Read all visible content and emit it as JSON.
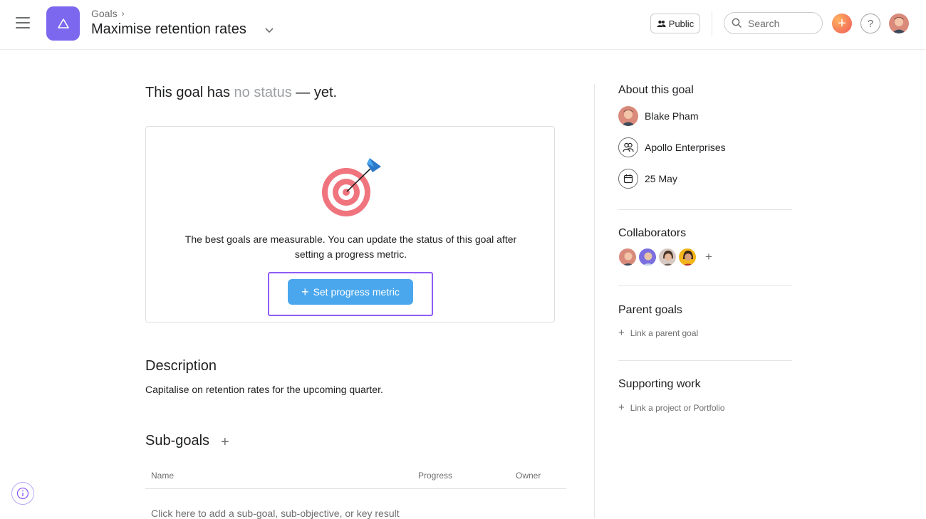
{
  "header": {
    "breadcrumb": "Goals",
    "title": "Maximise retention rates",
    "public_label": "Public",
    "search_placeholder": "Search",
    "help_label": "?"
  },
  "status": {
    "prefix": "This goal has",
    "highlight": "no status",
    "suffix": "— yet."
  },
  "metric_card": {
    "text_line1": "The best goals are measurable. You can update the status of this goal after",
    "text_line2": "setting a progress metric.",
    "button_label": "Set progress metric"
  },
  "description": {
    "heading": "Description",
    "text": "Capitalise on retention rates for the upcoming quarter."
  },
  "subgoals": {
    "heading": "Sub-goals",
    "columns": [
      "Name",
      "Progress",
      "Owner"
    ],
    "empty_row": "Click here to add a sub-goal, sub-objective, or key result"
  },
  "sidebar": {
    "about_heading": "About this goal",
    "owner": "Blake Pham",
    "team": "Apollo Enterprises",
    "due_date": "25 May",
    "collaborators_heading": "Collaborators",
    "parent_heading": "Parent goals",
    "parent_link": "Link a parent goal",
    "supporting_heading": "Supporting work",
    "supporting_link": "Link a project or Portfolio"
  },
  "colors": {
    "app_tile": "#7b68ee",
    "primary_button": "#4aa7ee",
    "highlight_frame": "#8f5cf7",
    "target_red": "#f0747d"
  }
}
